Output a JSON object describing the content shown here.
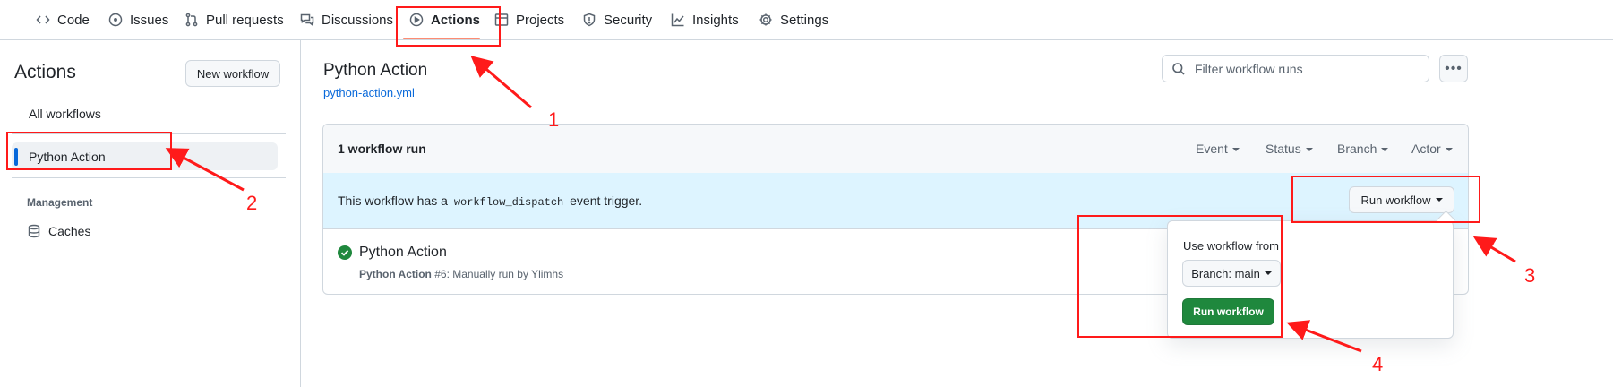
{
  "nav": {
    "tabs": [
      {
        "label": "Code",
        "icon": "code-icon"
      },
      {
        "label": "Issues",
        "icon": "issue-icon"
      },
      {
        "label": "Pull requests",
        "icon": "pull-request-icon"
      },
      {
        "label": "Discussions",
        "icon": "discussion-icon"
      },
      {
        "label": "Actions",
        "icon": "play-icon",
        "selected": true
      },
      {
        "label": "Projects",
        "icon": "table-icon"
      },
      {
        "label": "Security",
        "icon": "shield-icon"
      },
      {
        "label": "Insights",
        "icon": "graph-icon"
      },
      {
        "label": "Settings",
        "icon": "gear-icon"
      }
    ]
  },
  "sidebar": {
    "title": "Actions",
    "new_workflow_label": "New workflow",
    "all_workflows_label": "All workflows",
    "active_workflow_label": "Python Action",
    "management_heading": "Management",
    "caches_label": "Caches"
  },
  "main": {
    "title": "Python Action",
    "file_link": "python-action.yml",
    "filter_placeholder": "Filter workflow runs",
    "run_count": "1 workflow run",
    "filters": [
      "Event",
      "Status",
      "Branch",
      "Actor"
    ],
    "dispatch_prefix": "This workflow has a",
    "dispatch_code": "workflow_dispatch",
    "dispatch_suffix": "event trigger.",
    "run_workflow_label": "Run workflow",
    "run": {
      "title": "Python Action",
      "meta_workflow": "Python Action",
      "meta_rest": "#6: Manually run by Ylimhs",
      "status": "success"
    }
  },
  "dropdown": {
    "label": "Use workflow from",
    "branch_label": "Branch: main",
    "submit_label": "Run workflow"
  },
  "annotations": [
    "1",
    "2",
    "3",
    "4"
  ],
  "colors": {
    "accent_blue": "#0969da",
    "success_green": "#1f883d",
    "annotation_red": "#ff1a1a",
    "tab_underline": "#fd8c73",
    "dispatch_bg": "#ddf4ff"
  }
}
